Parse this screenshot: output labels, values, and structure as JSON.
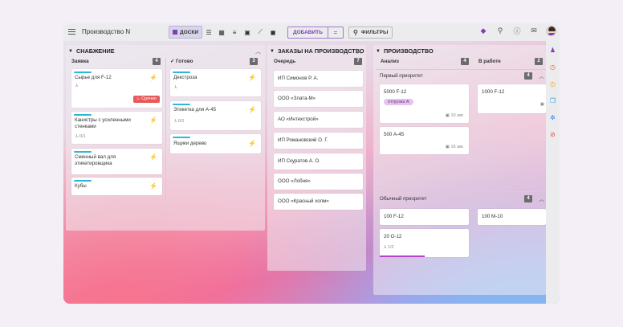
{
  "toolbar": {
    "title": "Производство N",
    "view_boards": "ДОСКИ",
    "add_label": "ДОБАВИТЬ",
    "filters_label": "ФИЛЬТРЫ"
  },
  "supply": {
    "title": "СНАБЖЕНИЕ",
    "col1": {
      "title": "Заявка",
      "count": "4"
    },
    "col2": {
      "title": "Готово",
      "count": "3"
    },
    "cards_req": [
      {
        "text": "Сырье для F-12",
        "badge": "Срочно"
      },
      {
        "text": "Канистры с усиленными стенками",
        "sub": "0/1"
      },
      {
        "text": "Сменный вал для этикетировщика"
      },
      {
        "text": "Кубы"
      }
    ],
    "cards_done": [
      {
        "text": "Декстроза"
      },
      {
        "text": "Этикетка для А-45",
        "sub": "0/1"
      },
      {
        "text": "Ящики дерево"
      }
    ]
  },
  "orders": {
    "title": "ЗАКАЗЫ НА ПРОИЗВОДСТВО",
    "col": {
      "title": "Очередь",
      "count": "7"
    },
    "cards": [
      "ИП Симонов Р. А.",
      "ООО «Злата-М»",
      "АО «Интехстрой»",
      "ИП Романовский О. Г.",
      "ИП Скуратов А. О.",
      "ООО «Лобня»",
      "ООО «Красный холм»"
    ]
  },
  "production": {
    "title": "ПРОИЗВОДСТВО",
    "col1": {
      "title": "Анализ",
      "count": "4"
    },
    "col2": {
      "title": "В работе",
      "count": "2"
    },
    "group1": {
      "title": "Первый приоритет",
      "count": "4"
    },
    "group2": {
      "title": "Обычный приоритет",
      "count": "4"
    },
    "card_5000": {
      "text": "5000 F-12",
      "tag": "отгрузка А",
      "date": "10 авг."
    },
    "card_500": {
      "text": "500 А-45",
      "date": "16 авг."
    },
    "card_1000": {
      "text": "1000 F-12"
    },
    "card_100f": {
      "text": "100 F-12"
    },
    "card_100m": {
      "text": "100 M-10"
    },
    "card_20": {
      "text": "20 O-12",
      "sub": "1/2",
      "progress": 0.5
    }
  }
}
